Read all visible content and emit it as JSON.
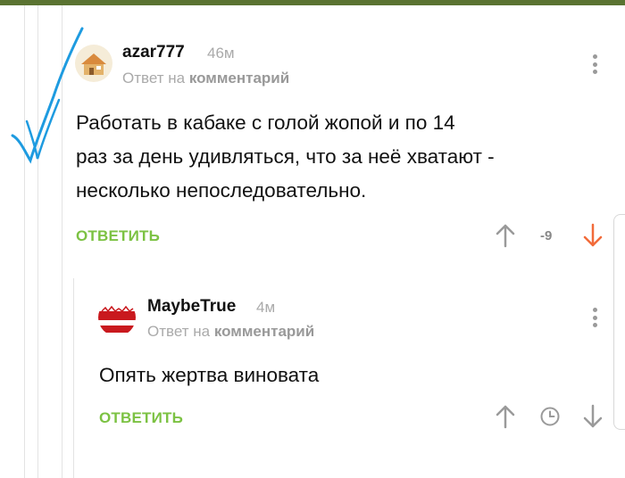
{
  "comments": [
    {
      "author": "azar777",
      "time": "46м",
      "reply_prefix": "Ответ на",
      "reply_target": "комментарий",
      "text_lines": [
        "Работать в кабаке с голой жопой и по 14",
        "раз за день удивляться, что за неё хватают -",
        "несколько непоследовательно."
      ],
      "reply_button": "ОТВЕТИТЬ",
      "score": "-9",
      "colors": {
        "down_arrow": "#f26b3a"
      }
    },
    {
      "author": "MaybeTrue",
      "time": "4м",
      "reply_prefix": "Ответ на",
      "reply_target": "комментарий",
      "text_lines": [
        "Опять жертва виновата"
      ],
      "reply_button": "ОТВЕТИТЬ"
    }
  ],
  "colors": {
    "accent": "#7cc243",
    "header": "#5a7331"
  }
}
